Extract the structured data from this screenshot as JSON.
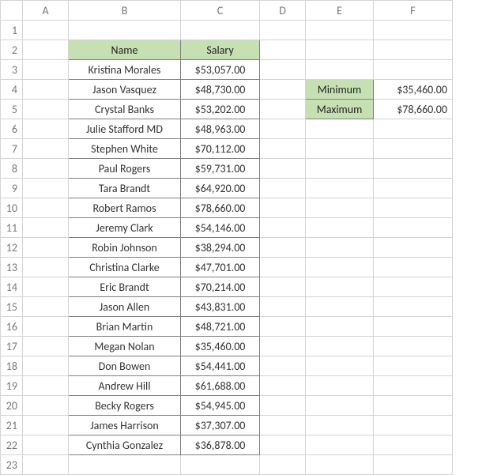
{
  "columns": [
    "A",
    "B",
    "C",
    "D",
    "E",
    "F"
  ],
  "rows": [
    "1",
    "2",
    "3",
    "4",
    "5",
    "6",
    "7",
    "8",
    "9",
    "10",
    "11",
    "12",
    "13",
    "14",
    "15",
    "16",
    "17",
    "18",
    "19",
    "20",
    "21",
    "22",
    "23"
  ],
  "headers": {
    "name": "Name",
    "salary": "Salary"
  },
  "people": [
    {
      "name": "Kristina Morales",
      "salary": "$53,057.00"
    },
    {
      "name": "Jason Vasquez",
      "salary": "$48,730.00"
    },
    {
      "name": "Crystal Banks",
      "salary": "$53,202.00"
    },
    {
      "name": "Julie Stafford MD",
      "salary": "$48,963.00"
    },
    {
      "name": "Stephen White",
      "salary": "$70,112.00"
    },
    {
      "name": "Paul Rogers",
      "salary": "$59,731.00"
    },
    {
      "name": "Tara Brandt",
      "salary": "$64,920.00"
    },
    {
      "name": "Robert Ramos",
      "salary": "$78,660.00"
    },
    {
      "name": "Jeremy Clark",
      "salary": "$54,146.00"
    },
    {
      "name": "Robin Johnson",
      "salary": "$38,294.00"
    },
    {
      "name": "Christina Clarke",
      "salary": "$47,701.00"
    },
    {
      "name": "Eric Brandt",
      "salary": "$70,214.00"
    },
    {
      "name": "Jason Allen",
      "salary": "$43,831.00"
    },
    {
      "name": "Brian Martin",
      "salary": "$48,721.00"
    },
    {
      "name": "Megan Nolan",
      "salary": "$35,460.00"
    },
    {
      "name": "Don Bowen",
      "salary": "$54,441.00"
    },
    {
      "name": "Andrew Hill",
      "salary": "$61,688.00"
    },
    {
      "name": "Becky Rogers",
      "salary": "$54,945.00"
    },
    {
      "name": "James Harrison",
      "salary": "$37,307.00"
    },
    {
      "name": "Cynthia Gonzalez",
      "salary": "$36,878.00"
    }
  ],
  "summary": {
    "min_label": "Minimum",
    "min_value": "$35,460.00",
    "max_label": "Maximum",
    "max_value": "$78,660.00"
  }
}
